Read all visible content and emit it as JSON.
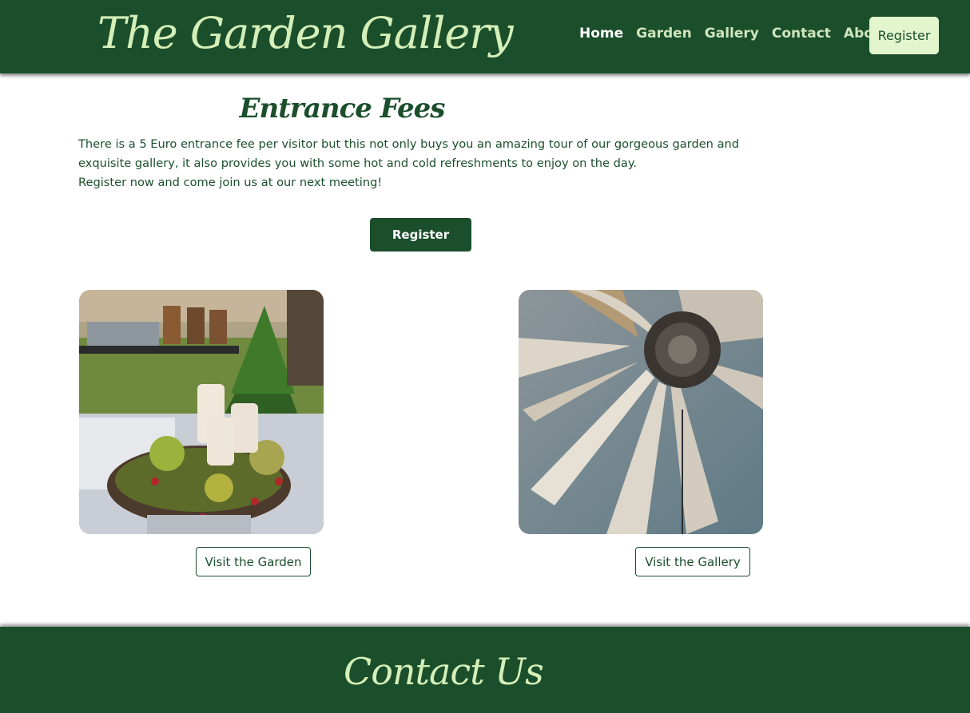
{
  "header": {
    "logo": "The Garden Gallery",
    "nav": [
      {
        "label": "Home"
      },
      {
        "label": "Garden"
      },
      {
        "label": "Gallery"
      },
      {
        "label": "Contact"
      },
      {
        "label": "About"
      }
    ],
    "register_label": "Register"
  },
  "main": {
    "title": "Entrance Fees",
    "paragraph1": "There is a 5 Euro entrance fee per visitor but this not only buys you an amazing tour of our gorgeous garden and exquisite gallery, it also provides you with some hot and cold refreshments to enjoy on the day.",
    "paragraph2": "Register now and come join us at our next meeting!",
    "register_label": "Register"
  },
  "cards": [
    {
      "image": "garden-table-candles-wreath-photo",
      "button_label": "Visit the Garden"
    },
    {
      "image": "white-flower-painting-photo",
      "button_label": "Visit the Gallery"
    }
  ],
  "footer": {
    "title": "Contact Us"
  },
  "colors": {
    "brand_green": "#1b4f2c",
    "logo_text": "#d5efb8",
    "nav_register_bg": "#e3f5cd"
  }
}
